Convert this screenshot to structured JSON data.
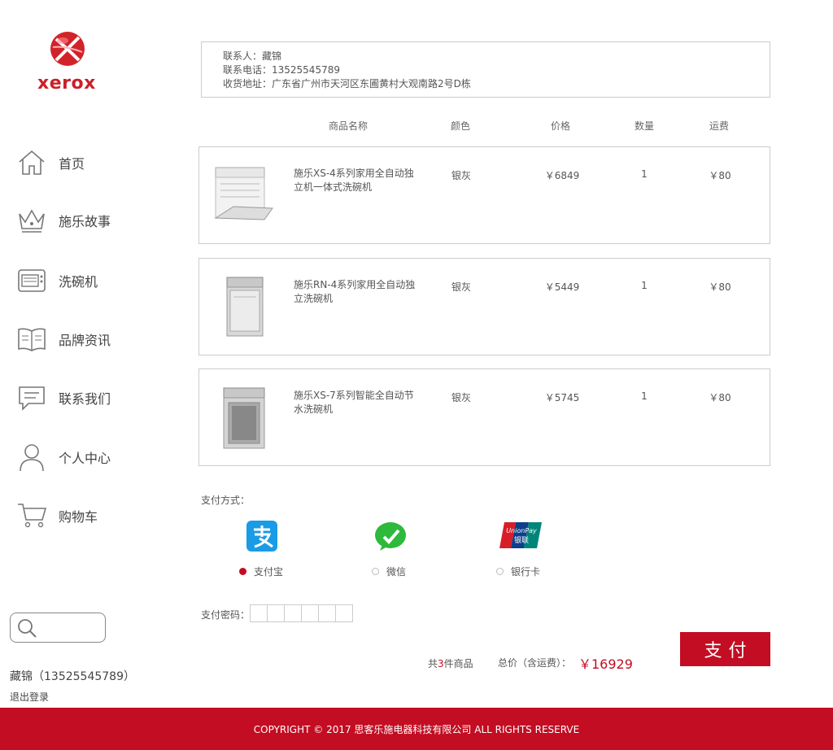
{
  "brand": {
    "name": "xerox",
    "color": "#cc1f29"
  },
  "sidebar": {
    "items": [
      {
        "label": "首页",
        "icon": "home-icon"
      },
      {
        "label": "施乐故事",
        "icon": "crown-icon"
      },
      {
        "label": "洗碗机",
        "icon": "dishwasher-icon"
      },
      {
        "label": "品牌资讯",
        "icon": "book-icon"
      },
      {
        "label": "联系我们",
        "icon": "chat-icon"
      },
      {
        "label": "个人中心",
        "icon": "user-icon"
      },
      {
        "label": "购物车",
        "icon": "cart-icon"
      }
    ],
    "search_icon": "search-icon",
    "user": "藏锦（13525545789）",
    "logout": "退出登录"
  },
  "address": {
    "contact": "联系人：藏锦",
    "phone": "联系电话：13525545789",
    "addr": "收货地址：广东省广州市天河区东圃黄村大观南路2号D栋"
  },
  "table": {
    "headers": {
      "name": "商品名称",
      "color": "颜色",
      "price": "价格",
      "qty": "数量",
      "shipping": "运费"
    },
    "rows": [
      {
        "name": "施乐XS-4系列家用全自动独立机一体式洗碗机",
        "color": "银灰",
        "price": "￥6849",
        "qty": "1",
        "shipping": "￥80"
      },
      {
        "name": "施乐RN-4系列家用全自动独立洗碗机",
        "color": "银灰",
        "price": "￥5449",
        "qty": "1",
        "shipping": "￥80"
      },
      {
        "name": "施乐XS-7系列智能全自动节水洗碗机",
        "color": "银灰",
        "price": "￥5745",
        "qty": "1",
        "shipping": "￥80"
      }
    ]
  },
  "payment": {
    "label": "支付方式：",
    "methods": [
      {
        "label": "支付宝",
        "icon": "alipay-icon",
        "selected": true
      },
      {
        "label": "微信",
        "icon": "wechat-icon",
        "selected": false
      },
      {
        "label": "银行卡",
        "icon": "unionpay-icon",
        "selected": false
      }
    ],
    "password_label": "支付密码："
  },
  "summary": {
    "count_prefix": "共",
    "count": "3",
    "count_suffix": "件商品",
    "total_label": "总价（含运费）：",
    "total": "￥16929",
    "pay_button": "支付"
  },
  "footer": "COPYRIGHT © 2017 思客乐施电器科技有限公司 ALL RIGHTS RESERVE",
  "accent": "#c30d23"
}
